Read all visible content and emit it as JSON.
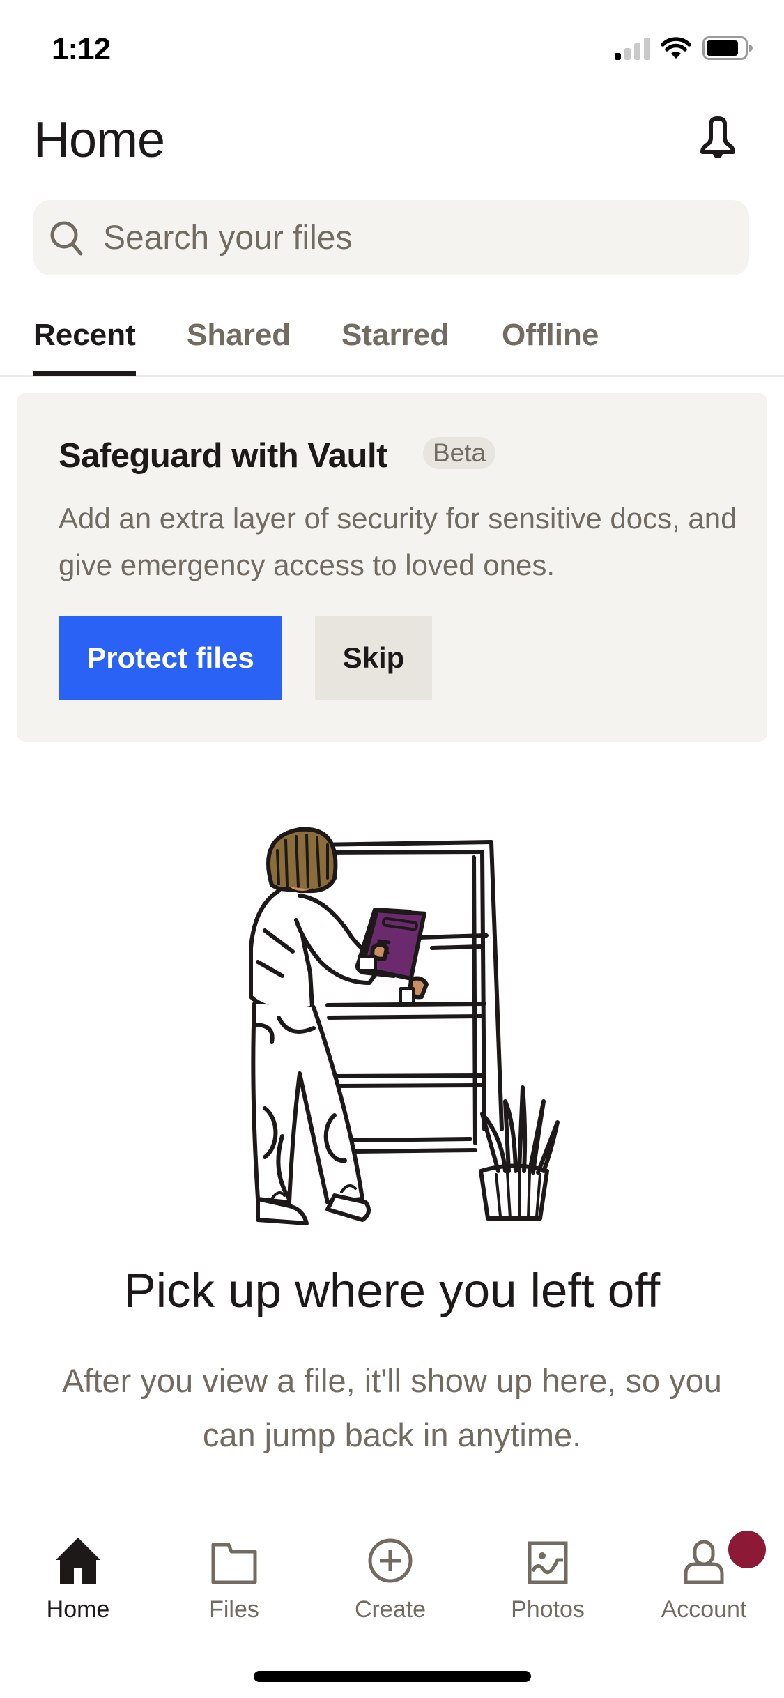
{
  "status_bar": {
    "time": "1:12",
    "focus_icon": "moon-icon",
    "signal_bars_active": 1,
    "signal_bars_total": 4,
    "wifi_icon": "wifi-icon",
    "battery_level": 0.85
  },
  "header": {
    "title": "Home",
    "notifications_icon": "bell-icon"
  },
  "search": {
    "placeholder": "Search your files",
    "value": "",
    "icon": "search-icon"
  },
  "tabs": [
    {
      "label": "Recent",
      "active": true
    },
    {
      "label": "Shared",
      "active": false
    },
    {
      "label": "Starred",
      "active": false
    },
    {
      "label": "Offline",
      "active": false
    }
  ],
  "vault_card": {
    "title": "Safeguard with Vault",
    "badge": "Beta",
    "body": "Add an extra layer of security for sensitive docs, and give emergency access to loved ones.",
    "primary_button": "Protect files",
    "secondary_button": "Skip"
  },
  "empty_state": {
    "illustration": "person-at-bookshelf-illustration",
    "title": "Pick up where you left off",
    "body": "After you view a file, it'll show up here, so you can jump back in anytime."
  },
  "bottom_nav": [
    {
      "label": "Home",
      "icon": "home-icon",
      "active": true
    },
    {
      "label": "Files",
      "icon": "folder-icon",
      "active": false
    },
    {
      "label": "Create",
      "icon": "create-plus-icon",
      "active": false
    },
    {
      "label": "Photos",
      "icon": "photos-icon",
      "active": false
    },
    {
      "label": "Account",
      "icon": "account-icon",
      "active": false,
      "badge": true
    }
  ],
  "colors": {
    "accent_blue": "#2962f5",
    "text_primary": "#1e1919",
    "text_secondary": "#716b61",
    "surface": "#f5f3f0",
    "badge": "#8c1a36",
    "book_purple": "#6b2a6e",
    "hair_brown": "#8a6d3b",
    "skin": "#c98f63"
  }
}
